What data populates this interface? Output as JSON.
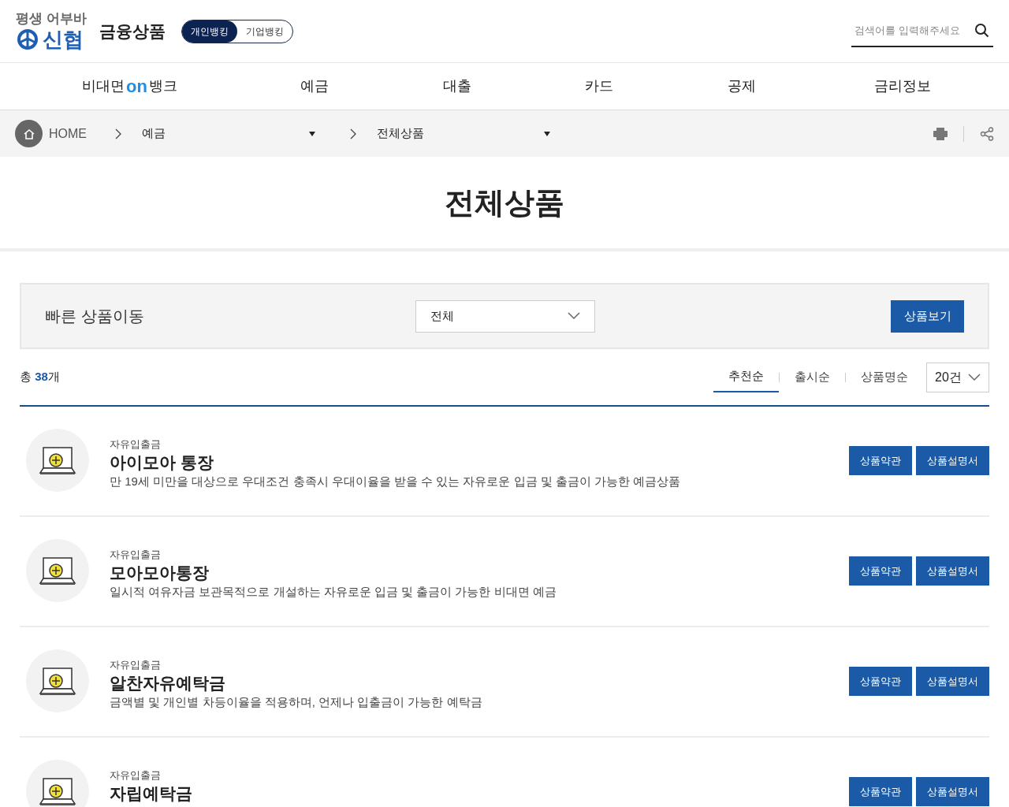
{
  "header": {
    "slogan": "평생 어부바",
    "logo_text": "신협",
    "title": "금융상품",
    "banking_tabs": [
      {
        "label": "개인뱅킹",
        "selected": true
      },
      {
        "label": "기업뱅킹",
        "selected": false
      }
    ],
    "search": {
      "placeholder": "검색어를 입력해주세요"
    }
  },
  "nav": [
    {
      "kind": "logo",
      "label": "비대면",
      "mark": "on",
      "suffix": "뱅크"
    },
    {
      "kind": "text",
      "label": "예금"
    },
    {
      "kind": "text",
      "label": "대출"
    },
    {
      "kind": "text",
      "label": "카드"
    },
    {
      "kind": "text",
      "label": "공제"
    },
    {
      "kind": "text",
      "label": "금리정보"
    }
  ],
  "breadcrumb": {
    "home": "HOME",
    "levels": [
      "예금",
      "전체상품"
    ]
  },
  "page_title": "전체상품",
  "quick_move": {
    "label": "빠른 상품이동",
    "select_value": "전체",
    "button": "상품보기"
  },
  "summary": {
    "prefix": "총 ",
    "count": "38",
    "suffix": "개"
  },
  "sort_tabs": [
    {
      "label": "추천순",
      "selected": true
    },
    {
      "label": "출시순",
      "selected": false
    },
    {
      "label": "상품명순",
      "selected": false
    }
  ],
  "page_size": "20건",
  "products": [
    {
      "category": "자유입출금",
      "name": "아이모아 통장",
      "description": "만 19세 미만을 대상으로 우대조건 충족시 우대이율을 받을 수 있는 자유로운 입금 및 출금이 가능한 예금상품",
      "buttons": [
        "상품약관",
        "상품설명서"
      ]
    },
    {
      "category": "자유입출금",
      "name": "모아모아통장",
      "description": "일시적 여유자금 보관목적으로 개설하는 자유로운 입금 및 출금이 가능한 비대면 예금",
      "buttons": [
        "상품약관",
        "상품설명서"
      ]
    },
    {
      "category": "자유입출금",
      "name": "알찬자유예탁금",
      "description": "금액별 및 개인별 차등이율을 적용하며, 언제나 입출금이 가능한 예탁금",
      "buttons": [
        "상품약관",
        "상품설명서"
      ]
    },
    {
      "category": "자유입출금",
      "name": "자립예탁금",
      "buttons": [
        "상품약관",
        "상품설명서"
      ]
    }
  ]
}
